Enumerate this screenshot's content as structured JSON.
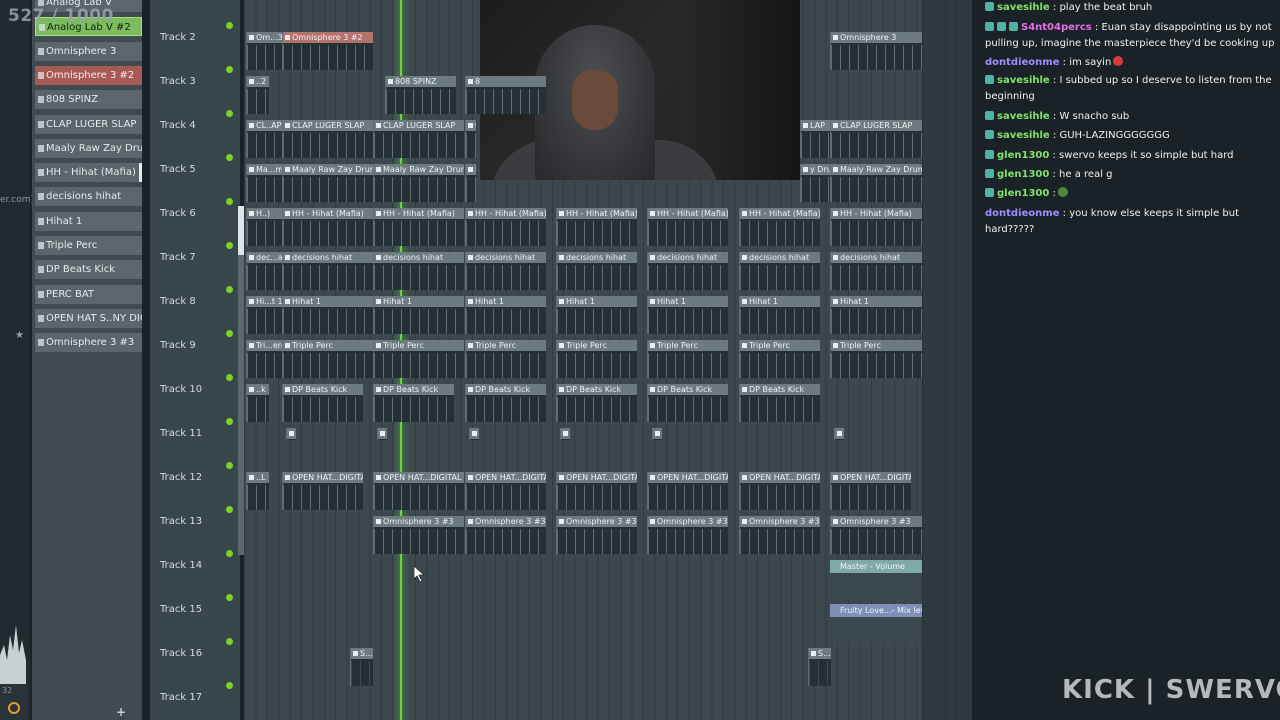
{
  "overlay": {
    "counter": "527 / 1000",
    "url_fragment": "er.com)",
    "bottom_left_text": "32"
  },
  "channels": [
    {
      "label": "Analog Lab V",
      "style": "normal"
    },
    {
      "label": "Analog Lab V #2",
      "style": "green"
    },
    {
      "label": "Omnisphere 3",
      "style": "normal"
    },
    {
      "label": "Omnisphere 3 #2",
      "style": "red"
    },
    {
      "label": "808 SPINZ",
      "style": "normal"
    },
    {
      "label": "CLAP LUGER SLAP",
      "style": "normal"
    },
    {
      "label": "Maaly Raw Zay Drum",
      "style": "normal"
    },
    {
      "label": "HH - Hihat (Mafia)",
      "style": "lbar"
    },
    {
      "label": "decisions hihat",
      "style": "normal"
    },
    {
      "label": "Hihat 1",
      "style": "normal"
    },
    {
      "label": "Triple Perc",
      "style": "normal"
    },
    {
      "label": "DP Beats Kick",
      "style": "normal"
    },
    {
      "label": "PERC BAT",
      "style": "normal"
    },
    {
      "label": "OPEN HAT S..NY DIGITAL",
      "style": "normal"
    },
    {
      "label": "Omnisphere 3 #3",
      "style": "normal"
    }
  ],
  "channel_add_label": "+",
  "tracks": [
    "Track 2",
    "Track 3",
    "Track 4",
    "Track 5",
    "Track 6",
    "Track 7",
    "Track 8",
    "Track 9",
    "Track 10",
    "Track 11",
    "Track 12",
    "Track 13",
    "Track 14",
    "Track 15",
    "Track 16",
    "Track 17"
  ],
  "clips": [
    {
      "track": 0,
      "items": [
        [
          "Om...3"
        ],
        [
          "Omnisphere 3 #2"
        ],
        [
          "Omnisphere 3"
        ]
      ]
    },
    {
      "track": 1,
      "items": [
        [
          "..2"
        ],
        [
          "808 SPINZ"
        ],
        [
          "808 SPINZ"
        ],
        [
          "8"
        ]
      ]
    },
    {
      "track": 2,
      "items": [
        [
          "CL..AP"
        ],
        [
          "CLAP LUGER SLAP"
        ],
        [
          "CLAP LUGER SLAP"
        ],
        [
          "C"
        ],
        [
          "LAP"
        ],
        [
          "CLAP LUGER SLAP"
        ]
      ]
    },
    {
      "track": 3,
      "items": [
        [
          "Ma...m"
        ],
        [
          "Maaly Raw Zay Drum"
        ],
        [
          "Maaly Raw Zay Drum"
        ],
        [
          "M"
        ],
        [
          "y Drum"
        ],
        [
          "Maaly Raw Zay Drum"
        ]
      ]
    },
    {
      "track": 4,
      "items": [
        [
          "H..)"
        ],
        [
          "HH - Hihat (Mafia)"
        ],
        [
          "HH - Hihat (Mafia)"
        ],
        [
          "HH - Hihat (Mafia)"
        ],
        [
          "HH - Hihat (Mafia)"
        ],
        [
          "HH - Hihat (Mafia)"
        ],
        [
          "HH - Hihat (Mafia)"
        ],
        [
          "HH - Hihat (Mafia)"
        ]
      ]
    },
    {
      "track": 5,
      "items": [
        [
          "dec...at"
        ],
        [
          "decisions hihat"
        ],
        [
          "decisions hihat"
        ],
        [
          "decisions hihat"
        ],
        [
          "decisions hihat"
        ],
        [
          "decisions hihat"
        ],
        [
          "decisions hihat"
        ],
        [
          "decisions hihat"
        ]
      ]
    },
    {
      "track": 6,
      "items": [
        [
          "Hi...t 1"
        ],
        [
          "Hihat 1"
        ],
        [
          "Hihat 1"
        ],
        [
          "Hihat 1"
        ],
        [
          "Hihat 1"
        ],
        [
          "Hihat 1"
        ],
        [
          "Hihat 1"
        ],
        [
          "Hihat 1"
        ]
      ]
    },
    {
      "track": 7,
      "items": [
        [
          "Tri...erc"
        ],
        [
          "Triple Perc"
        ],
        [
          "Triple Perc"
        ],
        [
          "Triple Perc"
        ],
        [
          "Triple Perc"
        ],
        [
          "Triple Perc"
        ],
        [
          "Triple Perc"
        ],
        [
          "Triple Perc"
        ]
      ]
    },
    {
      "track": 8,
      "items": [
        [
          "..k"
        ],
        [
          "DP Beats Kick"
        ],
        [
          "DP Beats Kick"
        ],
        [
          "DP Beats Kick"
        ],
        [
          "DP Beats Kick"
        ],
        [
          "DP Beats Kick"
        ],
        [
          "DP Beats Kick"
        ]
      ]
    },
    {
      "track": 10,
      "items": [
        [
          "..L"
        ],
        [
          "OPEN HAT...DIGITAL"
        ],
        [
          "OPEN HAT...DIGITAL"
        ],
        [
          "OPEN HAT...DIGITAL"
        ],
        [
          "OPEN HAT...DIGITAL"
        ],
        [
          "OPEN HAT...DIGITAL"
        ],
        [
          "OPEN HAT...DIGITAL"
        ],
        [
          "OPEN HAT...DIGITAL"
        ]
      ]
    },
    {
      "track": 11,
      "items": [
        [
          "Omnisphere 3 #3"
        ],
        [
          "Omnisphere 3 #3"
        ],
        [
          "Omnisphere 3 #3"
        ],
        [
          "Omnisphere 3 #3"
        ],
        [
          "Omnisphere 3 #3"
        ],
        [
          "Omnisphere 3 #3"
        ]
      ]
    },
    {
      "track": 14,
      "items": [
        [
          "S..."
        ],
        [
          "S..."
        ]
      ]
    }
  ],
  "automation": [
    {
      "track": 12,
      "label": "Master - Volume",
      "color": "#7fa9a4"
    },
    {
      "track": 13,
      "label": "Fruity Love...- Mix level",
      "color": "#7f8fb8"
    }
  ],
  "chat": [
    {
      "user": "savesihle",
      "color": "#7fe36a",
      "text": ": play the beat bruh",
      "badges": 1
    },
    {
      "user": "S4nt04percs",
      "color": "#e070e8",
      "text": ": Euan stay disappointing us by not pulling up, imagine the masterpiece they'd be cooking up",
      "badges": 3
    },
    {
      "user": "dontdieonme",
      "color": "#a08cff",
      "text": ": im sayin",
      "badges": 0,
      "emote": "#d63a3a"
    },
    {
      "user": "savesihle",
      "color": "#7fe36a",
      "text": ": I subbed up so I deserve to listen from the beginning",
      "badges": 1
    },
    {
      "user": "savesihle",
      "color": "#7fe36a",
      "text": ": W snacho sub",
      "badges": 1
    },
    {
      "user": "savesihle",
      "color": "#7fe36a",
      "text": ": GUH-LAZINGGGGGGG",
      "badges": 1
    },
    {
      "user": "glen1300",
      "color": "#7fe36a",
      "text": ": swervo keeps it so simple but hard",
      "badges": 1
    },
    {
      "user": "glen1300",
      "color": "#7fe36a",
      "text": ": he a real g",
      "badges": 1
    },
    {
      "user": "glen1300",
      "color": "#7fe36a",
      "text": ":",
      "badges": 1,
      "emote": "#4d8a3a"
    },
    {
      "user": "dontdieonme",
      "color": "#a08cff",
      "text": ": you know else keeps it simple but hard?????",
      "badges": 0
    }
  ],
  "watermark": "KICK | SWERVO"
}
